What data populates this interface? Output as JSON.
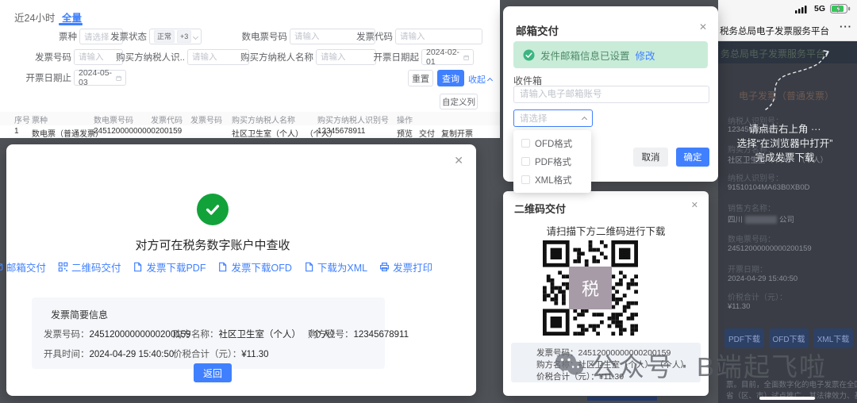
{
  "colors": {
    "accent": "#4080ff",
    "success_green": "#12a23a",
    "banner_green": "#c9ecd9",
    "backdrop_gray": "#4f5257"
  },
  "app": {
    "tabs": {
      "recent": "近24小时",
      "all": "全量"
    },
    "filters": {
      "ticket_type": {
        "label": "票种",
        "placeholder": "请选择"
      },
      "invoice_status": {
        "label": "发票状态",
        "tag_normal": "正常",
        "tag_more": "+3"
      },
      "digital_no": {
        "label": "数电票号码",
        "placeholder": "请输入"
      },
      "invoice_code": {
        "label": "发票代码",
        "placeholder": "请输入"
      },
      "invoice_no": {
        "label": "发票号码",
        "placeholder": "请输入"
      },
      "buyer_taxid": {
        "label": "购买方纳税人识..",
        "placeholder": "请输入"
      },
      "buyer_name": {
        "label": "购买方纳税人名称",
        "placeholder": "请输入"
      },
      "date_from": {
        "label": "开票日期起",
        "value": "2024-02-01"
      },
      "date_to": {
        "label": "开票日期止",
        "value": "2024-05-03"
      }
    },
    "actions": {
      "reset": "重置",
      "search": "查询",
      "collapse": "收起",
      "customize": "自定义列"
    },
    "table": {
      "headers": [
        "序号",
        "票种",
        "数电票号码",
        "发票代码",
        "发票号码",
        "购买方纳税人名称",
        "购买方纳税人识别号",
        "操作"
      ],
      "row": {
        "seq": "1",
        "type": "数电票（普通发票）",
        "number": "24512000000000200159",
        "buyer_name": "社区卫生室（个人） （个人）",
        "buyer_taxid": "12345678911"
      },
      "row_actions": [
        "预览",
        "交付",
        "复制开票"
      ]
    }
  },
  "result_dialog": {
    "message": "对方可在税务数字账户中查收",
    "actions": [
      "邮箱交付",
      "二维码交付",
      "发票下载PDF",
      "发票下载OFD",
      "下载为XML",
      "发票打印"
    ],
    "summary_title": "发票简要信息",
    "summary": {
      "invoice_no_label": "发票号码：",
      "invoice_no": "24512000000000200159",
      "buyer_label": "购方名称：",
      "buyer": "社区卫生室（个人） （个人）",
      "buyer_taxid_label": "购方税号：",
      "buyer_taxid": "12345678911",
      "issue_time_label": "开具时间：",
      "issue_time": "2024-04-29 15:40:50",
      "total_label": "价税合计（元）：",
      "total": "¥11.30"
    },
    "back": "返回"
  },
  "email_dialog": {
    "title": "邮箱交付",
    "banner": "发件邮箱信息已设置",
    "banner_link": "修改",
    "recipient_label": "收件箱",
    "recipient_placeholder": "请输入电子邮箱账号",
    "format_placeholder": "请选择",
    "options": [
      "OFD格式",
      "PDF格式",
      "XML格式"
    ],
    "cancel": "取消",
    "confirm": "确定"
  },
  "qr_dialog": {
    "title": "二维码交付",
    "hint": "请扫描下方二维码进行下载",
    "qr_center": "税",
    "info": {
      "invoice_no_label": "发票号码：",
      "invoice_no": "24512000000000200159",
      "buyer_label": "购方名称：",
      "buyer": "社区卫生室（个人） （个人）",
      "total_label": "价税合计（元）：",
      "total": "¥11.30"
    }
  },
  "phone": {
    "network": "5G",
    "title": "税务总局电子发票服务平台",
    "menu": "···",
    "banner": "务总局电子发票服务平台",
    "page_title": "电子发票（普通发票）",
    "tips": [
      "请点击右上角 ···",
      "选择“在浏览器中打开”",
      "完成发票下载"
    ],
    "fields": {
      "buyer_taxid": {
        "label": "纳税人识别号：",
        "value": "12345678911"
      },
      "buyer_name": {
        "label": "购买方名称：",
        "value": "社区卫生室（个人） （个人）"
      },
      "seller_taxid": {
        "label": "纳税人识别号：",
        "value": "91510104MA63B0XB0D"
      },
      "seller_name": {
        "label": "销售方名称：",
        "prefix": "四川",
        "suffix": "公司"
      },
      "digital_no": {
        "label": "数电票号码：",
        "value": "24512000000000200159"
      },
      "issue_date": {
        "label": "开票日期：",
        "value": "2024-04-29 15:40:50"
      },
      "total": {
        "label": "价税合计（元）：",
        "value": "¥11.30"
      }
    },
    "buttons": [
      "PDF下载",
      "OFD下载",
      "XML下载"
    ],
    "footnote": [
      "票。目前，全面数字化的电子发票在全国部分",
      "省（区、市）试点推广，其法律效力、基本用"
    ]
  },
  "watermark": {
    "part1": "公众号",
    "separator": "·",
    "part2": "B端起飞啦"
  }
}
